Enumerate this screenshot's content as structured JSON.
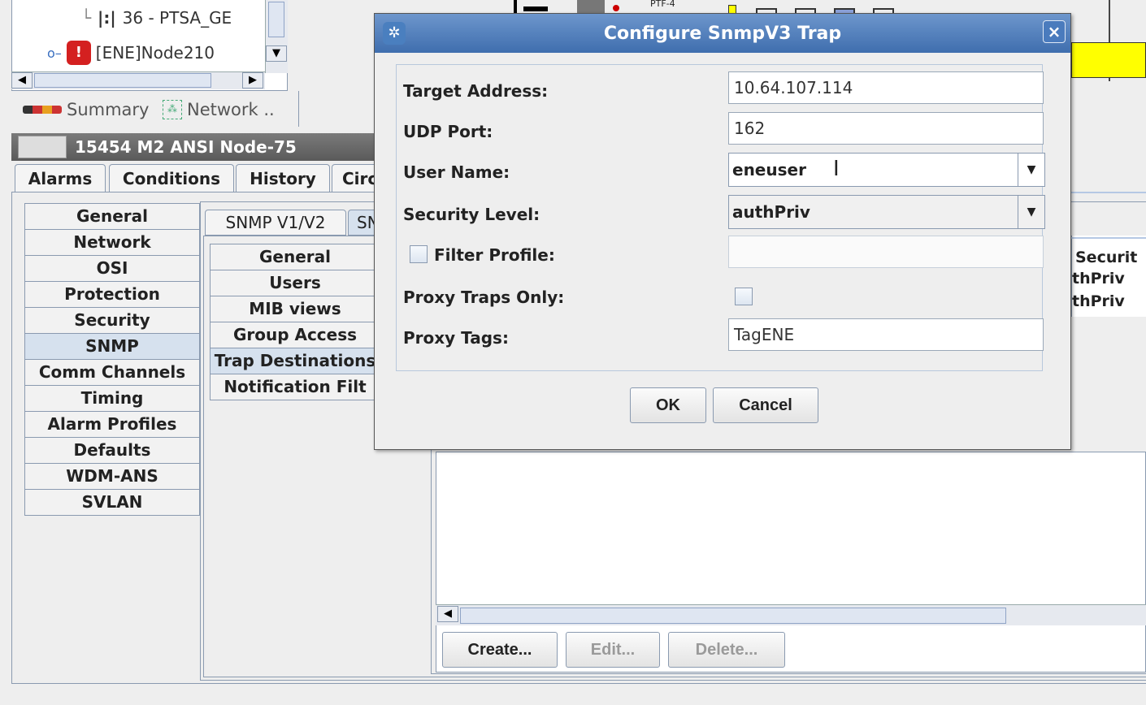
{
  "tree": {
    "items": [
      {
        "label": "36 - PTSA_GE"
      },
      {
        "label": "[ENE]Node210"
      }
    ],
    "tabs": [
      {
        "label": "Summary"
      },
      {
        "label": "Network .."
      }
    ]
  },
  "node_window": {
    "title": "15454 M2 ANSI Node-75",
    "top_tabs": [
      "Alarms",
      "Conditions",
      "History",
      "Circ"
    ],
    "left_tabs": [
      "General",
      "Network",
      "OSI",
      "Protection",
      "Security",
      "SNMP",
      "Comm Channels",
      "Timing",
      "Alarm Profiles",
      "Defaults",
      "WDM-ANS",
      "SVLAN"
    ],
    "left_selected": "SNMP",
    "snmp_tabs": [
      "SNMP V1/V2",
      "SN"
    ],
    "snmp_subtabs": [
      "General",
      "Users",
      "MIB views",
      "Group Access",
      "Trap Destinations",
      "Notification Filt"
    ],
    "snmp_subtab_selected": "Trap Destinations",
    "table_partial": {
      "header": "Securit",
      "rows": [
        "thPriv",
        "thPriv"
      ]
    },
    "buttons": {
      "create": "Create...",
      "edit": "Edit...",
      "delete": "Delete..."
    }
  },
  "dialog": {
    "title": "Configure SnmpV3 Trap",
    "close_label": "×",
    "fields": {
      "target_address": {
        "label": "Target Address:",
        "value": "10.64.107.114"
      },
      "udp_port": {
        "label": "UDP Port:",
        "value": "162"
      },
      "user_name": {
        "label": "User Name:",
        "value": "eneuser"
      },
      "security_level": {
        "label": "Security Level:",
        "value": "authPriv"
      },
      "filter_profile": {
        "label": "Filter Profile:",
        "value": "",
        "checked": false
      },
      "proxy_traps_only": {
        "label": "Proxy Traps Only:",
        "checked": false
      },
      "proxy_tags": {
        "label": "Proxy Tags:",
        "value": "TagENE"
      }
    },
    "buttons": {
      "ok": "OK",
      "cancel": "Cancel"
    }
  },
  "background_strip": {
    "label": "PTF-4"
  },
  "colors": {
    "title_bar": "#3f6eae",
    "selected_tab": "#d6e1ee",
    "yellow_band": "#ffff00"
  }
}
